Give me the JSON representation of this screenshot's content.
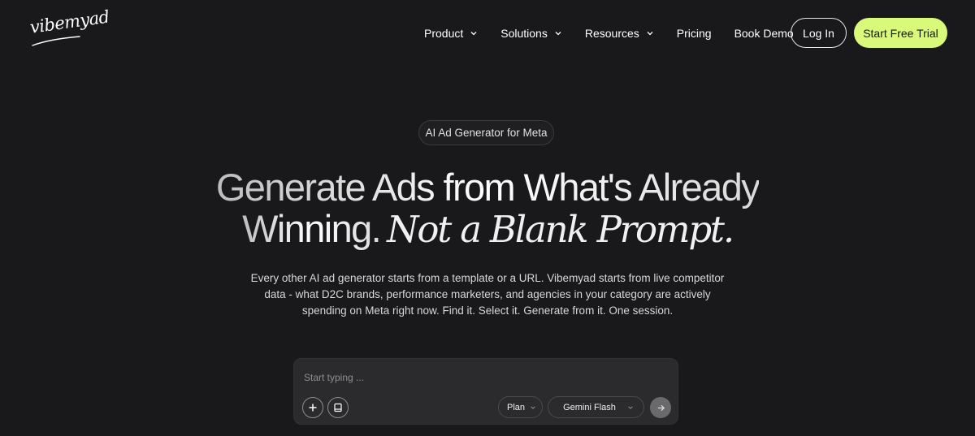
{
  "brand": {
    "logo_text": "vibemyad"
  },
  "nav": {
    "items": [
      {
        "label": "Product",
        "has_dropdown": true
      },
      {
        "label": "Solutions",
        "has_dropdown": true
      },
      {
        "label": "Resources",
        "has_dropdown": true
      },
      {
        "label": "Pricing",
        "has_dropdown": false
      },
      {
        "label": "Book Demo",
        "has_dropdown": false
      }
    ],
    "login_label": "Log In",
    "trial_label": "Start Free Trial"
  },
  "hero": {
    "badge": "AI Ad Generator for Meta",
    "headline_line1": "Generate Ads from What's Already",
    "headline_line2_main": "Winning.",
    "headline_line2_accent": "Not a Blank Prompt.",
    "subtext_lines": [
      "Every other AI ad generator starts from a template or a URL. Vibemyad starts from live competitor",
      "data - what D2C brands, performance marketers, and agencies in your category are actively",
      "spending on Meta right now. Find it. Select it. Generate from it. One session."
    ]
  },
  "prompt": {
    "value": "",
    "placeholder": "Start typing ...",
    "plan_select": "Plan",
    "model_select": "Gemini Flash",
    "icons": [
      "plus-icon",
      "document-icon",
      "chevron-down-icon",
      "arrow-right-icon"
    ]
  },
  "colors": {
    "background": "#19181a",
    "accent": "#d9f97a",
    "input_bg": "#2b2a2d"
  }
}
